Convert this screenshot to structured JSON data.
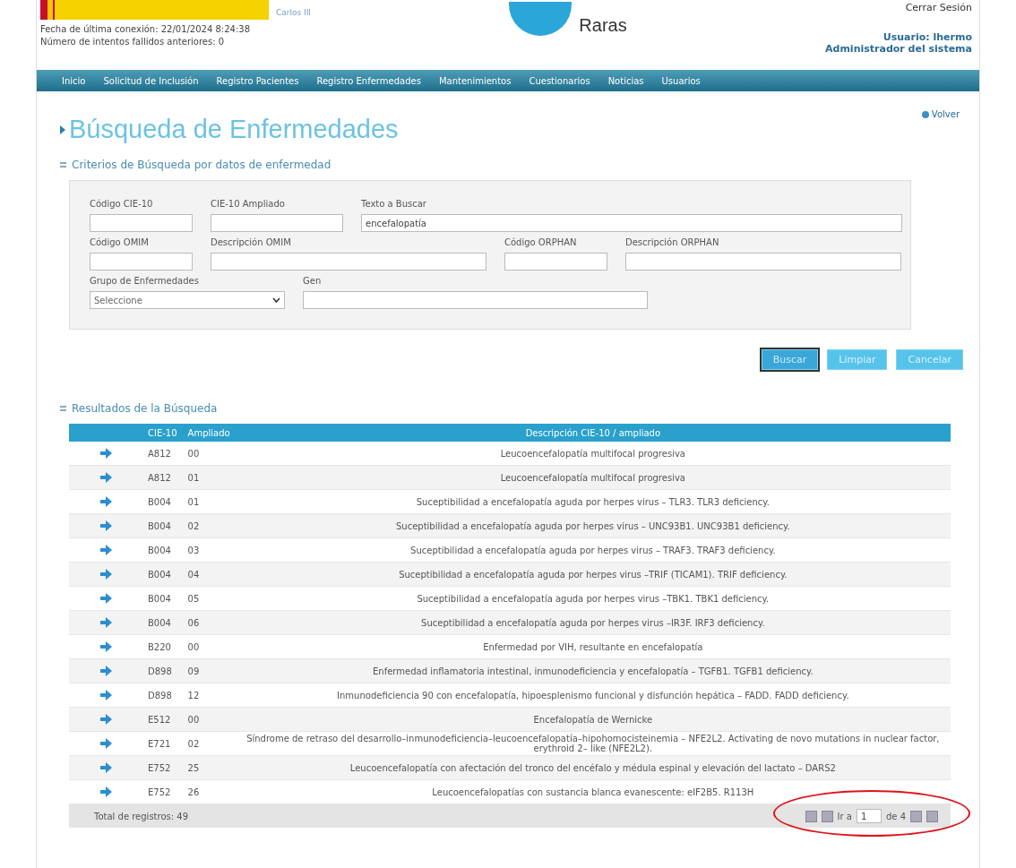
{
  "header": {
    "institute_text": "Carlos III",
    "last_login": "Fecha de última conexión: 22/01/2024 8:24:38",
    "failed_attempts": "Número de intentos fallidos anteriores: 0",
    "brand_text": "Raras",
    "logout": "Cerrar Sesión",
    "user": "Usuario: lhermo",
    "role": "Administrador del sistema"
  },
  "nav": [
    "Inicio",
    "Solicitud de Inclusión",
    "Registro Pacientes",
    "Registro Enfermedades",
    "Mantenimientos",
    "Cuestionarios",
    "Noticias",
    "Usuarios"
  ],
  "page_title": "Búsqueda de Enfermedades",
  "back_link": "Volver",
  "criteria": {
    "title": "Criterios de Búsqueda por datos de enfermedad",
    "rows": [
      [
        {
          "label": "Código CIE-10",
          "kind": "text"
        },
        {
          "label": "CIE-10 Ampliado",
          "kind": "text"
        },
        {
          "label": "Texto a Buscar",
          "value": "encefalopatía",
          "kind": "text"
        }
      ],
      [
        {
          "label": "Código OMIM",
          "kind": "text"
        },
        {
          "label": "Descripción OMIM",
          "kind": "text"
        },
        {
          "label": "Código ORPHAN",
          "kind": "text"
        },
        {
          "label": "Descripción ORPHAN",
          "kind": "text"
        }
      ],
      [
        {
          "label": "Grupo de Enfermedades",
          "value": "Seleccione",
          "kind": "select"
        },
        {
          "label": "Gen",
          "kind": "text"
        }
      ]
    ]
  },
  "buttons": [
    {
      "label": "Buscar",
      "focused": true
    },
    {
      "label": "Limpiar",
      "focused": false
    },
    {
      "label": "Cancelar",
      "focused": false
    }
  ],
  "results": {
    "title": "Resultados de la Búsqueda",
    "columns": [
      "CIE-10",
      "Ampliado",
      "Descripción CIE-10 / ampliado"
    ],
    "rows": [
      [
        "A812",
        "00",
        "Leucoencefalopatía multifocal progresiva"
      ],
      [
        "A812",
        "01",
        "Leucoencefalopatía multifocal progresiva"
      ],
      [
        "B004",
        "01",
        "Suceptibilidad a encefalopatía aguda por herpes virus – TLR3. TLR3 deficiency."
      ],
      [
        "B004",
        "02",
        "Suceptibilidad a encefalopatía aguda por herpes virus – UNC93B1. UNC93B1 deficiency."
      ],
      [
        "B004",
        "03",
        "Suceptibilidad a encefalopatía aguda por herpes virus – TRAF3. TRAF3 deficiency."
      ],
      [
        "B004",
        "04",
        "Suceptibilidad a encefalopatía aguda por herpes virus –TRIF (TICAM1). TRIF deficiency."
      ],
      [
        "B004",
        "05",
        "Suceptibilidad a encefalopatía aguda por herpes virus –TBK1. TBK1 deficiency."
      ],
      [
        "B004",
        "06",
        "Suceptibilidad a encefalopatía aguda por herpes virus –IR3F. IRF3 deficiency."
      ],
      [
        "B220",
        "00",
        "Enfermedad por VIH, resultante en encefalopatía"
      ],
      [
        "D898",
        "09",
        "Enfermedad inflamatoria intestinal, inmunodeficiencia y encefalopatía – TGFB1. TGFB1 deficiency."
      ],
      [
        "D898",
        "12",
        "Inmunodeficiencia 90 con encefalopatía, hipoesplenismo funcional y disfunción hepática – FADD. FADD deficiency."
      ],
      [
        "E512",
        "00",
        "Encefalopatía de Wernicke"
      ],
      [
        "E721",
        "02",
        "Síndrome de retraso del desarrollo–inmunodeficiencia–leucoencefalopatía–hipohomocisteinemia – NFE2L2. Activating de novo mutations in nuclear factor, erythroid 2– like (NFE2L2)."
      ],
      [
        "E752",
        "25",
        "Leucoencefalopatía con afectación del tronco del encéfalo y médula espinal y elevación del lactato – DARS2"
      ],
      [
        "E752",
        "26",
        "Leucoencefalopatías con sustancia blanca evanescente: eIF2B5. R113H"
      ]
    ],
    "total": "Total de registros: 49",
    "pager": {
      "go_label": "Ir a",
      "page": "1",
      "of_label": "de 4"
    }
  }
}
